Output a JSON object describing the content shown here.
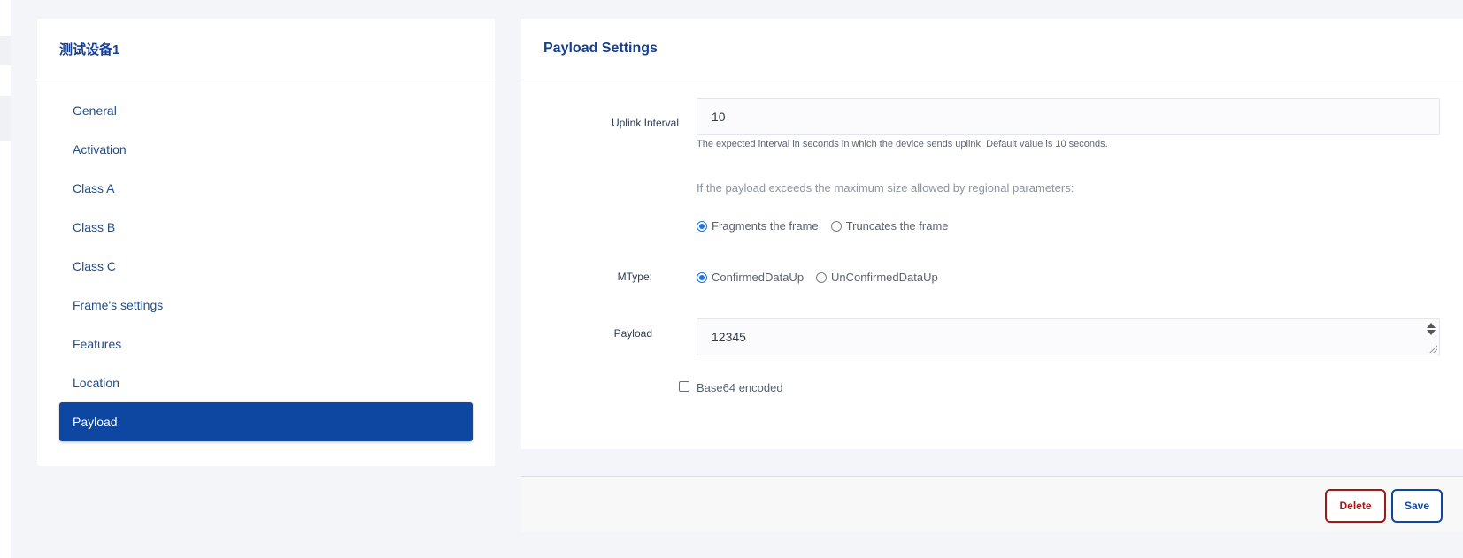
{
  "sidebar": {
    "title": "测试设备1",
    "items": [
      {
        "label": "General"
      },
      {
        "label": "Activation"
      },
      {
        "label": "Class A"
      },
      {
        "label": "Class B"
      },
      {
        "label": "Class C"
      },
      {
        "label": "Frame's settings"
      },
      {
        "label": "Features"
      },
      {
        "label": "Location"
      },
      {
        "label": "Payload"
      }
    ],
    "active_item": "Payload"
  },
  "main": {
    "title": "Payload Settings",
    "uplink_interval": {
      "label": "Uplink Interval",
      "value": "10",
      "help": "The expected interval in seconds in which the device sends uplink. Default value is 10 seconds."
    },
    "payload_size_note": "If the payload exceeds the maximum size allowed by regional parameters:",
    "frame_options": [
      {
        "label": "Fragments the frame",
        "checked": true
      },
      {
        "label": "Truncates the frame",
        "checked": false
      }
    ],
    "mtype": {
      "label": "MType:",
      "options": [
        {
          "label": "ConfirmedDataUp",
          "checked": true
        },
        {
          "label": "UnConfirmedDataUp",
          "checked": false
        }
      ]
    },
    "payload": {
      "label": "Payload",
      "value": "12345"
    },
    "base64": {
      "label": "Base64 encoded",
      "checked": false
    }
  },
  "footer": {
    "delete_label": "Delete",
    "save_label": "Save"
  },
  "colors": {
    "accent": "#0d47a1",
    "danger": "#a01818",
    "radio": "#1a73e8"
  }
}
